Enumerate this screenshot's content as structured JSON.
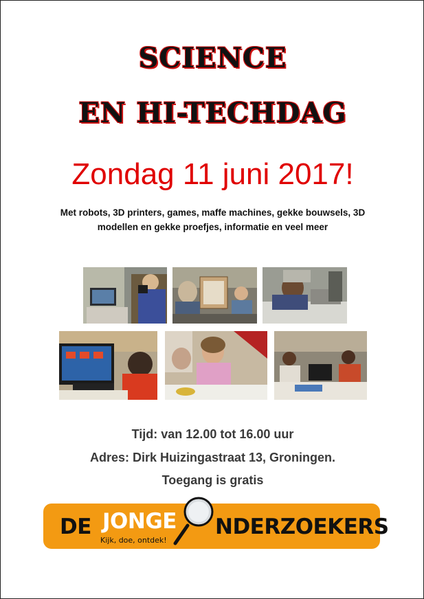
{
  "poster": {
    "title_line1": "SCIENCE",
    "title_line2": "EN HI-TECHDAG",
    "date": "Zondag 11 juni 2017!",
    "description_line1": "Met robots, 3D printers, games, maffe machines, gekke bouwsels, 3D",
    "description_line2": "modellen en gekke proefjes, informatie en veel meer",
    "time": "Tijd: van 12.00 tot 16.00 uur",
    "address": "Adres: Dirk Huizingastraat 13, Groningen.",
    "admission": "Toegang is gratis"
  },
  "logo": {
    "word1": "DE",
    "word2": "JONGE",
    "word3": "NDERZOEKERS",
    "tagline": "Kijk, doe, ontdek!",
    "icon": "magnifying-glass-icon",
    "colors": {
      "background": "#f39a12",
      "text_dark": "#111111",
      "text_light": "#ffffff"
    }
  },
  "colors": {
    "title_outline": "#cc1111",
    "date": "#e00000"
  },
  "photos": [
    {
      "name": "photo-microscope"
    },
    {
      "name": "photo-3d-printer"
    },
    {
      "name": "photo-lab-workbench"
    },
    {
      "name": "photo-computer-headphones"
    },
    {
      "name": "photo-girl-experiment"
    },
    {
      "name": "photo-classroom-laptops"
    }
  ]
}
